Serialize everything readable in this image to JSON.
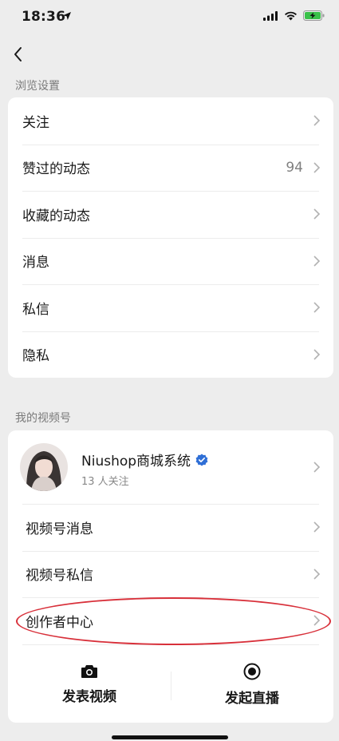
{
  "status": {
    "time": "18:36"
  },
  "sections": {
    "browse_label": "浏览设置",
    "channels_label": "我的视频号"
  },
  "browse_items": [
    {
      "label": "关注"
    },
    {
      "label": "赞过的动态",
      "count": "94"
    },
    {
      "label": "收藏的动态"
    },
    {
      "label": "消息"
    },
    {
      "label": "私信"
    },
    {
      "label": "隐私"
    }
  ],
  "profile": {
    "name": "Niushop商城系统",
    "followers": "13 人关注"
  },
  "channel_items": [
    {
      "label": "视频号消息"
    },
    {
      "label": "视频号私信"
    },
    {
      "label": "创作者中心"
    }
  ],
  "actions": {
    "post_video": "发表视频",
    "go_live": "发起直播"
  },
  "colors": {
    "verified": "#2f6fd6",
    "highlight": "#d8303a",
    "battery": "#3ac14a"
  }
}
